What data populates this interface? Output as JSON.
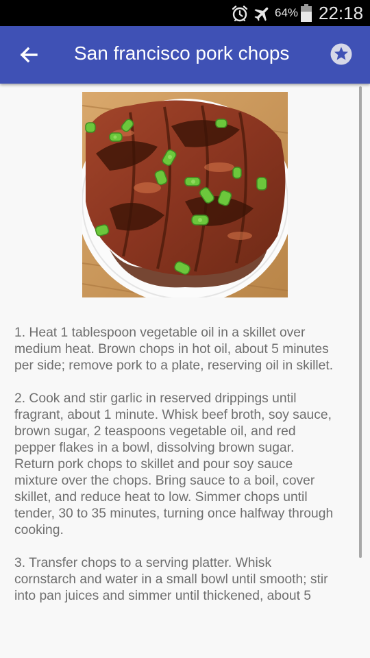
{
  "status_bar": {
    "battery_percent": "64%",
    "time": "22:18"
  },
  "app_bar": {
    "title": "San francisco pork chops",
    "back_icon": "arrow-left",
    "favorite_icon": "star-circle"
  },
  "recipe": {
    "instructions": "1. Heat 1 tablespoon vegetable oil in a skillet over\nmedium heat. Brown chops in hot oil, about 5 minutes\nper side; remove pork to a plate, reserving oil in skillet.\n\n2. Cook and stir garlic in reserved drippings until\nfragrant, about 1 minute. Whisk beef broth, soy sauce,\nbrown sugar, 2 teaspoons vegetable oil, and red\npepper flakes in a bowl, dissolving brown sugar.\nReturn pork chops to skillet and pour soy sauce\nmixture over the chops. Bring sauce to a boil, cover\nskillet, and reduce heat to low. Simmer chops until\ntender, 30 to 35 minutes, turning once halfway through\ncooking.\n\n3. Transfer chops to a serving platter. Whisk\ncornstarch and water in a small bowl until smooth; stir\ninto pan juices and simmer until thickened, about 5"
  }
}
